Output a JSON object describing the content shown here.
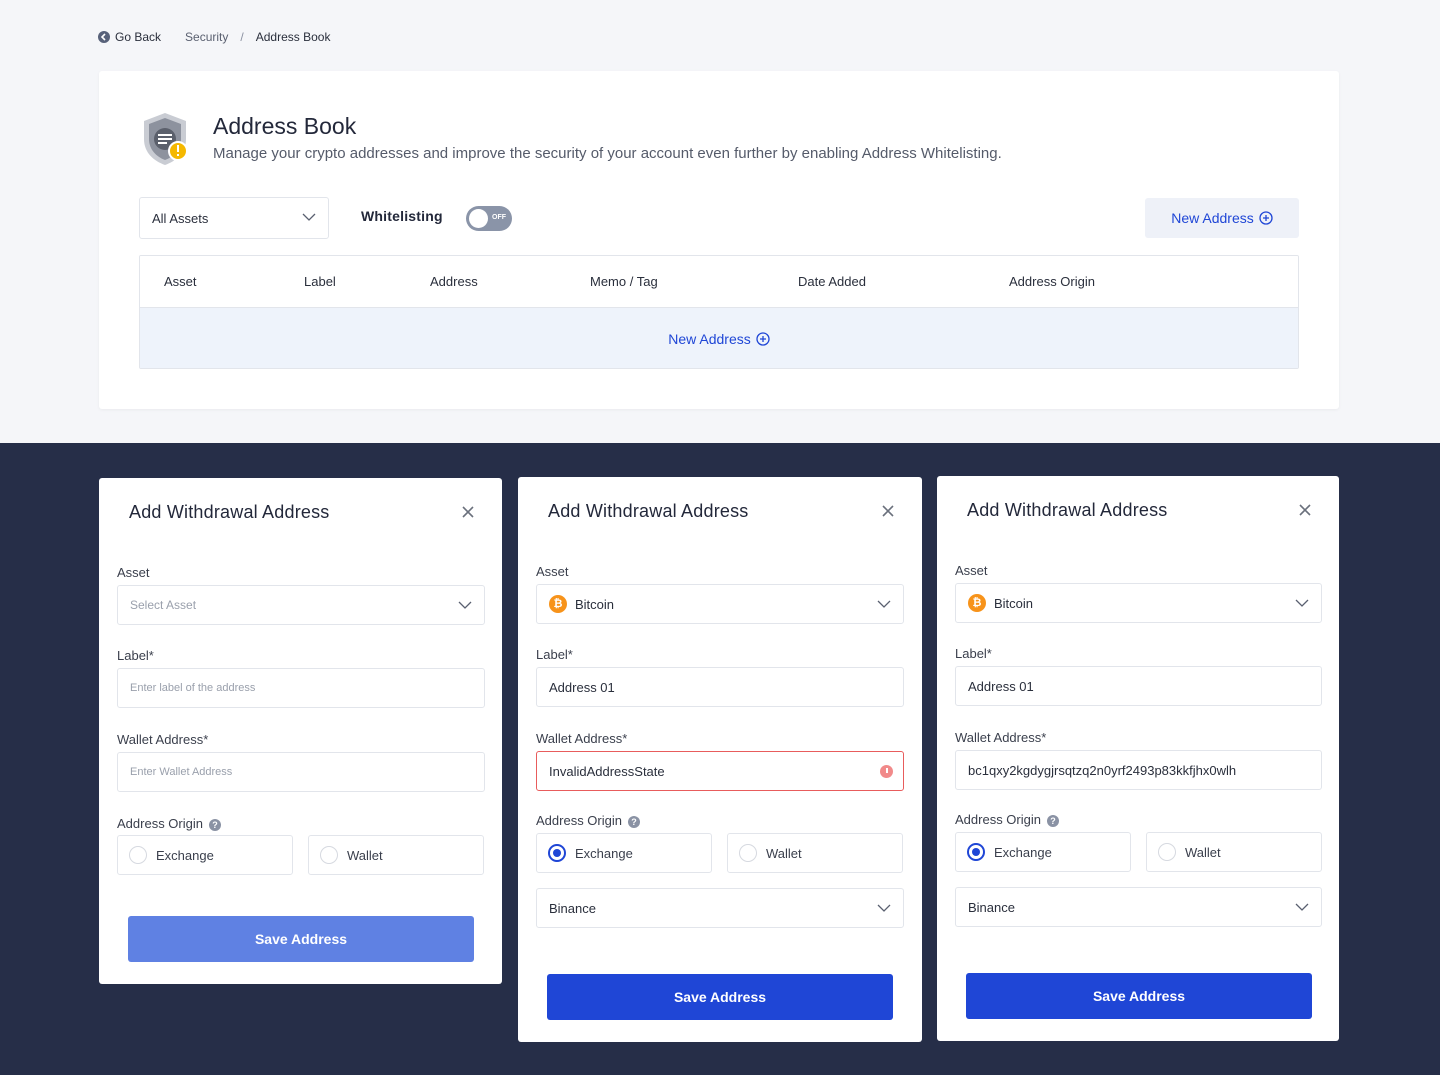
{
  "breadcrumb": {
    "go_back": "Go Back",
    "section": "Security",
    "separator": "/",
    "current": "Address Book"
  },
  "header": {
    "title": "Address Book",
    "subtitle": "Manage your crypto addresses and improve the security of your account even further by enabling Address Whitelisting."
  },
  "toolbar": {
    "asset_filter": "All Assets",
    "whitelisting_label": "Whitelisting",
    "whitelisting_state": "OFF",
    "new_address": "New Address"
  },
  "table": {
    "columns": [
      "Asset",
      "Label",
      "Address",
      "Memo / Tag",
      "Date Added",
      "Address Origin"
    ],
    "empty_action": "New Address"
  },
  "modals": [
    {
      "title": "Add Withdrawal Address",
      "asset_label": "Asset",
      "asset_value": "Select Asset",
      "label_label": "Label*",
      "label_value": "Enter label of the address",
      "wallet_label": "Wallet Address*",
      "wallet_value": "Enter Wallet Address",
      "origin_label": "Address Origin",
      "origin_exchange": "Exchange",
      "origin_wallet": "Wallet",
      "save": "Save Address"
    },
    {
      "title": "Add Withdrawal Address",
      "asset_label": "Asset",
      "asset_value": "Bitcoin",
      "label_label": "Label*",
      "label_value": "Address 01",
      "wallet_label": "Wallet Address*",
      "wallet_value": "InvalidAddressState",
      "origin_label": "Address Origin",
      "origin_exchange": "Exchange",
      "origin_wallet": "Wallet",
      "exchange_select": "Binance",
      "save": "Save Address"
    },
    {
      "title": "Add Withdrawal Address",
      "asset_label": "Asset",
      "asset_value": "Bitcoin",
      "label_label": "Label*",
      "label_value": "Address 01",
      "wallet_label": "Wallet Address*",
      "wallet_value": "bc1qxy2kgdygjrsqtzq2n0yrf2493p83kkfjhx0wlh",
      "origin_label": "Address Origin",
      "origin_exchange": "Exchange",
      "origin_wallet": "Wallet",
      "exchange_select": "Binance",
      "save": "Save Address"
    }
  ],
  "colors": {
    "accent": "#1f46d6",
    "dark_bg": "#262e48",
    "error": "#e85c5c",
    "bitcoin": "#f7931a",
    "warning": "#f5b800"
  },
  "icons": [
    "back-icon",
    "shield-icon",
    "chevron-down-icon",
    "plus-circle-icon",
    "close-icon",
    "bitcoin-icon",
    "help-icon",
    "error-icon"
  ]
}
